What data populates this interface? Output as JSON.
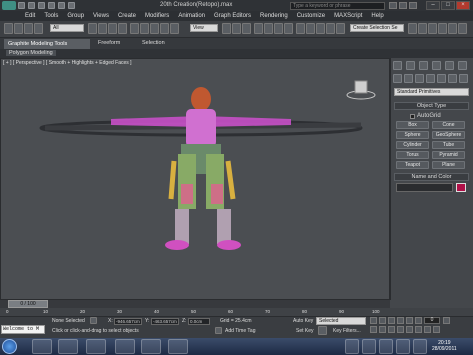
{
  "window": {
    "title": "20th Creation(Retopo).max",
    "search_placeholder": "Type a keyword or phrase"
  },
  "menu": [
    "Edit",
    "Tools",
    "Group",
    "Views",
    "Create",
    "Modifiers",
    "Animation",
    "Graph Editors",
    "Rendering",
    "Customize",
    "MAXScript",
    "Help"
  ],
  "toolbar": {
    "filter_value": "All",
    "view_value": "View",
    "selection_set_value": "Create Selection Se"
  },
  "ribbon": {
    "tabs": [
      "Graphite Modeling Tools",
      "Freeform",
      "Selection"
    ],
    "sub_label": "Polygon Modeling"
  },
  "viewport": {
    "label": "[ + ] [ Perspective ] [ Smooth + Highlights + Edged Faces ]"
  },
  "command_panel": {
    "dropdown": "Standard Primitives",
    "object_type_header": "Object Type",
    "autogrid_label": "AutoGrid",
    "primitives": [
      "Box",
      "Cone",
      "Sphere",
      "GeoSphere",
      "Cylinder",
      "Tube",
      "Torus",
      "Pyramid",
      "Teapot",
      "Plane"
    ],
    "name_color_header": "Name and Color",
    "swatch_color": "#b01048"
  },
  "timeline": {
    "slider_label": "0 / 100",
    "ticks": [
      "0",
      "10",
      "20",
      "30",
      "40",
      "50",
      "60",
      "70",
      "80",
      "90",
      "100"
    ]
  },
  "status": {
    "maxscript": "Welcome to M",
    "selection": "None Selected",
    "prompt": "Click or click-and-drag to select objects",
    "x_label": "X:",
    "x_value": "-946.657cm",
    "y_label": "Y:",
    "y_value": "-463.657cm",
    "z_label": "Z:",
    "z_value": "0.0cm",
    "grid": "Grid = 25.4cm",
    "add_time_tag": "Add Time Tag",
    "auto_key": "Auto Key",
    "set_key": "Set Key",
    "key_set_value": "Selected",
    "key_filters": "Key Filters...",
    "frame": "0"
  },
  "taskbar": {
    "time": "20:19",
    "date": "28/09/2011"
  }
}
